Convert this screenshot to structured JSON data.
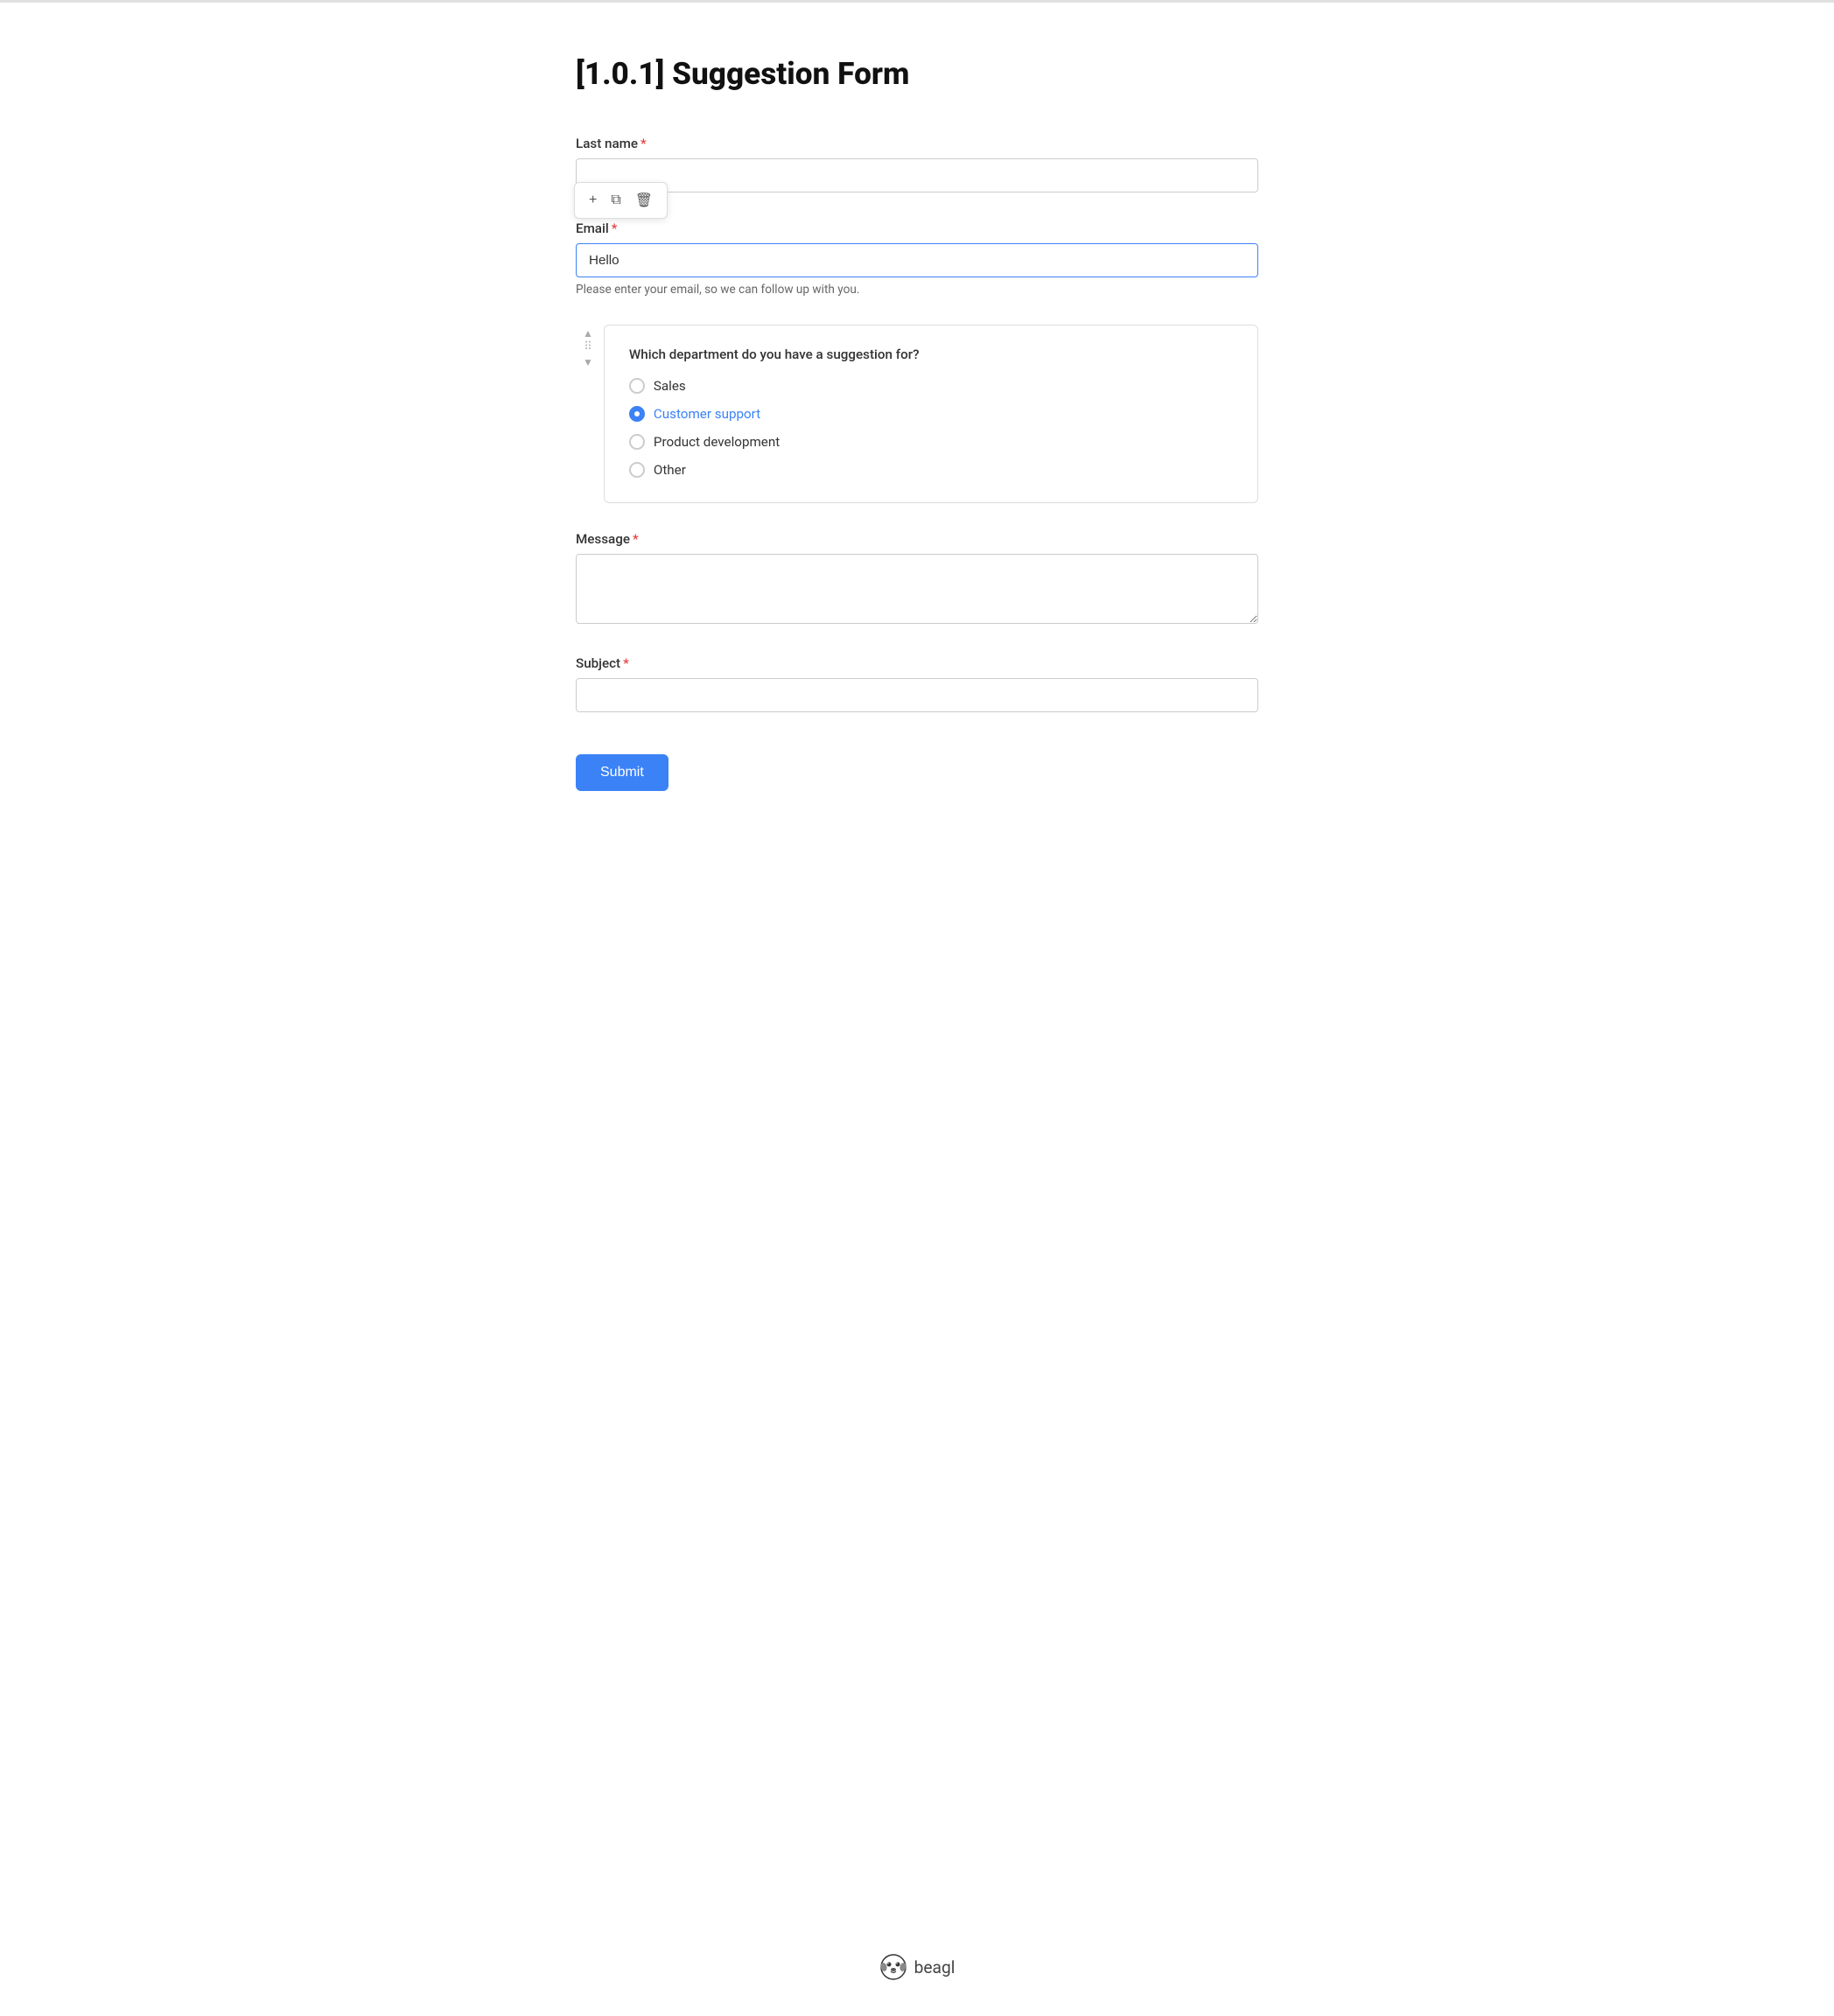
{
  "page": {
    "title": "[1.0.1] Suggestion Form",
    "top_border": true
  },
  "form": {
    "fields": {
      "last_name": {
        "label": "Last name",
        "required": true,
        "value": "",
        "placeholder": ""
      },
      "email": {
        "label": "Email",
        "required": true,
        "value": "Hello",
        "placeholder": "",
        "helper_text": "Please enter your email, so we can follow up with you."
      },
      "department": {
        "question": "Which department do you have a suggestion for?",
        "options": [
          {
            "label": "Sales",
            "value": "sales",
            "selected": false
          },
          {
            "label": "Customer support",
            "value": "customer_support",
            "selected": true
          },
          {
            "label": "Product development",
            "value": "product_development",
            "selected": false
          },
          {
            "label": "Other",
            "value": "other",
            "selected": false
          }
        ]
      },
      "message": {
        "label": "Message",
        "required": true,
        "value": ""
      },
      "subject": {
        "label": "Subject",
        "required": true,
        "value": ""
      }
    },
    "toolbar": {
      "add_label": "+",
      "copy_label": "⧉",
      "delete_label": "🗑"
    },
    "submit_label": "Submit"
  },
  "footer": {
    "brand": "beagl"
  }
}
